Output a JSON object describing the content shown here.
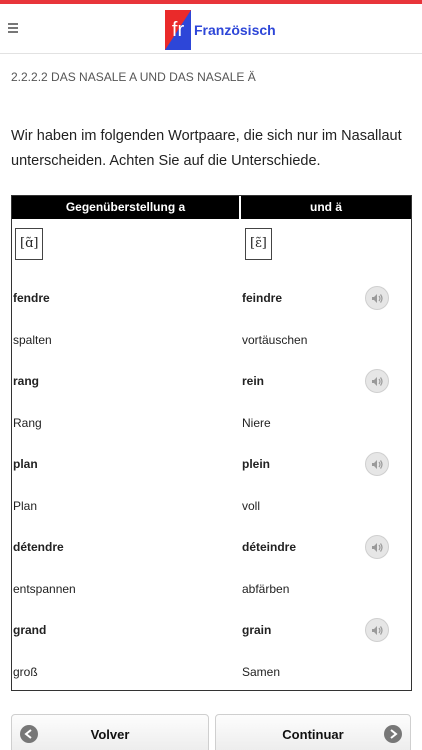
{
  "header": {
    "logo_text": "fr",
    "title": "Französisch"
  },
  "section": {
    "title": "2.2.2.2 DAS NASALE A UND DAS NASALE Ä",
    "intro": "Wir haben im folgenden Wortpaare, die sich nur im Nasallaut unterscheiden. Achten Sie auf die Unterschiede."
  },
  "table": {
    "headers": [
      "Gegenüberstellung a",
      "und ä"
    ],
    "ipa": [
      "[ɑ̃]",
      "[ɛ̃]"
    ],
    "rows": [
      {
        "a": "fendre",
        "b": "feindre",
        "bold": true,
        "audio": true
      },
      {
        "a": "spalten",
        "b": "vortäuschen",
        "bold": false,
        "audio": false
      },
      {
        "a": "rang",
        "b": "rein",
        "bold": true,
        "audio": true
      },
      {
        "a": "Rang",
        "b": "Niere",
        "bold": false,
        "audio": false
      },
      {
        "a": "plan",
        "b": "plein",
        "bold": true,
        "audio": true
      },
      {
        "a": "Plan",
        "b": "voll",
        "bold": false,
        "audio": false
      },
      {
        "a": "détendre",
        "b": "déteindre",
        "bold": true,
        "audio": true
      },
      {
        "a": "entspannen",
        "b": "abfärben",
        "bold": false,
        "audio": false
      },
      {
        "a": "grand",
        "b": "grain",
        "bold": true,
        "audio": true
      },
      {
        "a": "groß",
        "b": "Samen",
        "bold": false,
        "audio": false
      }
    ]
  },
  "nav": {
    "prev_label": "Volver",
    "next_label": "Continuar"
  },
  "colors": {
    "accent_red": "#e8353a",
    "brand_blue": "#2d46d8",
    "header_bg": "#000000"
  },
  "icons": {
    "menu": "hamburger-menu-icon",
    "audio": "speaker-icon",
    "prev": "arrow-left-icon",
    "next": "arrow-right-icon"
  }
}
